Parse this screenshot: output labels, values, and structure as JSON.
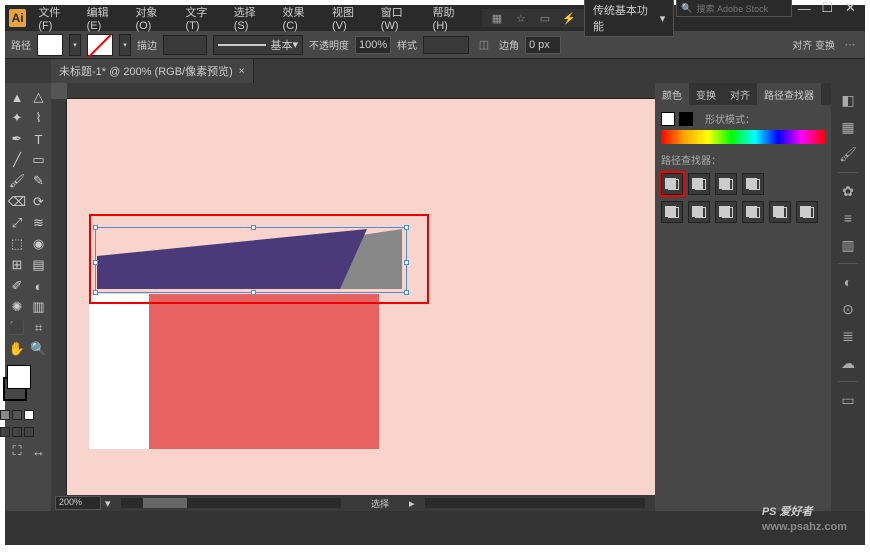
{
  "app": {
    "logo": "Ai"
  },
  "menu": {
    "items": [
      "文件(F)",
      "编辑(E)",
      "对象(O)",
      "文字(T)",
      "选择(S)",
      "效果(C)",
      "视图(V)",
      "窗口(W)",
      "帮助(H)"
    ]
  },
  "workspace": {
    "label": "传统基本功能",
    "search_placeholder": "搜索 Adobe Stock"
  },
  "window_controls": {
    "min": "—",
    "max": "☐",
    "close": "✕"
  },
  "control": {
    "path_label": "路径",
    "stroke_label": "描边",
    "stroke_weight": "",
    "stroke_style": "基本",
    "opacity_label": "不透明度",
    "opacity": "100%",
    "style_label": "样式",
    "align_label": "对齐 变换",
    "corner_label": "边角",
    "corner_value": "0 px"
  },
  "doc": {
    "tab_title": "未标题-1* @ 200% (RGB/像素预览)"
  },
  "tools": {
    "items": [
      "sel",
      "dsel",
      "wand",
      "lasso",
      "pen",
      "type",
      "line",
      "rect",
      "brush",
      "pencil",
      "eraser",
      "rot",
      "scale",
      "width",
      "warp",
      "shb",
      "mesh",
      "grad",
      "eyed",
      "blend",
      "sym",
      "graph",
      "art",
      "slice",
      "hand",
      "zoom"
    ],
    "fill": "#ffffff",
    "stroke": "#000000"
  },
  "canvas": {
    "zoom": "200%",
    "status": "选择"
  },
  "panels": {
    "tab_color": "颜色",
    "tab_transform": "变换",
    "tab_align": "对齐",
    "tab_pathfinder": "路径查找器",
    "shape_mode": "形状模式：",
    "pathfinder_label": "路径查找器："
  },
  "watermark": {
    "main": "PS 爱好者",
    "url": "www.psahz.com"
  },
  "icons": {
    "chevron": "▾",
    "search": "🔍",
    "unite": "◧",
    "minus": "◨",
    "intersect": "◩",
    "exclude": "◪",
    "divide": "▦",
    "trim": "▤",
    "merge": "▥",
    "crop": "▧",
    "outline": "▢",
    "back": "◫"
  }
}
